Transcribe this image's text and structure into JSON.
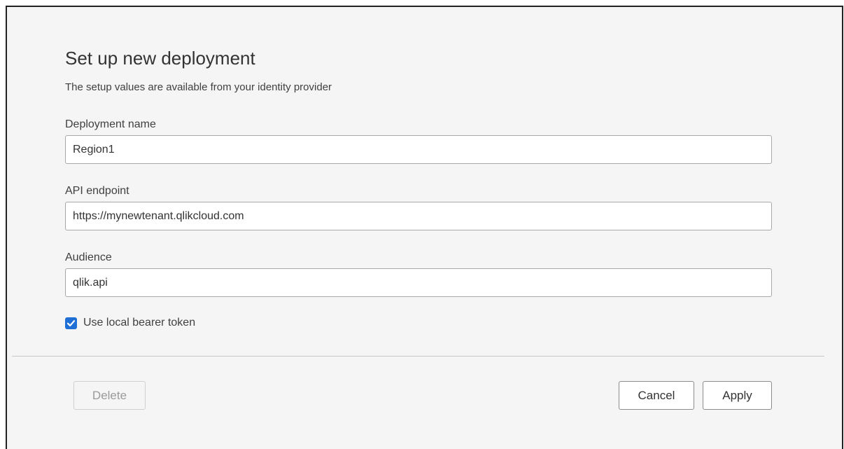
{
  "dialog": {
    "title": "Set up new deployment",
    "subtitle": "The setup values are available from your identity provider"
  },
  "fields": {
    "deployment_name": {
      "label": "Deployment name",
      "value": "Region1"
    },
    "api_endpoint": {
      "label": "API endpoint",
      "value": "https://mynewtenant.qlikcloud.com"
    },
    "audience": {
      "label": "Audience",
      "value": "qlik.api"
    }
  },
  "checkbox": {
    "label": "Use local bearer token",
    "checked": true,
    "icon": "checkmark-icon",
    "color": "#1f6fd6"
  },
  "buttons": {
    "delete": "Delete",
    "cancel": "Cancel",
    "apply": "Apply"
  }
}
